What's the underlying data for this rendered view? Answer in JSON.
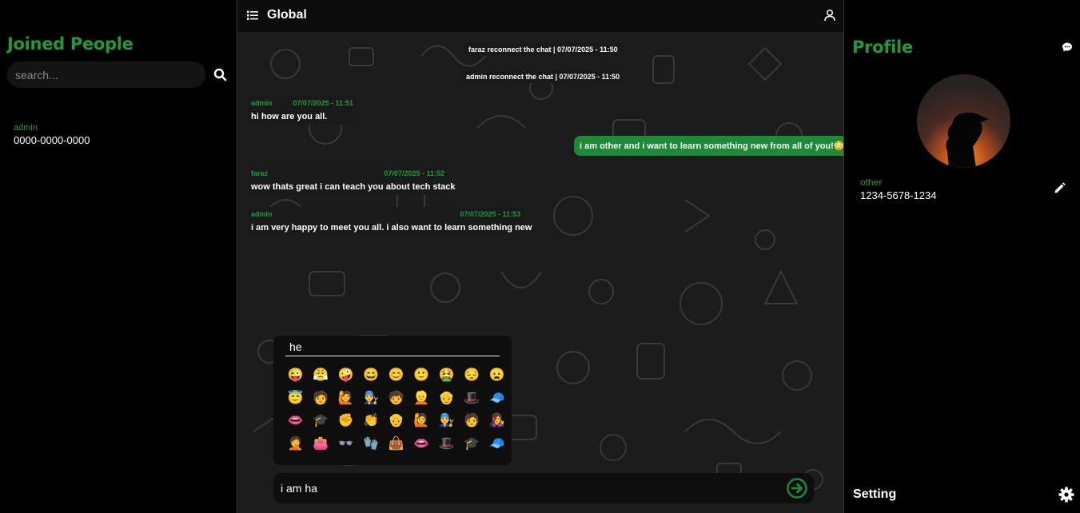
{
  "left": {
    "title": "Joined People",
    "search_placeholder": "search...",
    "people": [
      {
        "name": "admin",
        "phone": "0000-0000-0000"
      }
    ]
  },
  "chat": {
    "title": "Global",
    "system_messages": [
      "faraz reconnect the chat | 07/07/2025 - 11:50",
      "admin reconnect the chat | 07/07/2025 - 11:50"
    ],
    "messages": [
      {
        "sender": "admin",
        "time": "07/07/2025 - 11:51",
        "text": "hi how are you all."
      },
      {
        "mine": true,
        "text": "i am other and i want to learn something new from all of you!😳"
      },
      {
        "sender": "faraz",
        "time": "07/07/2025 - 11:52",
        "text": "wow thats great i can teach you about tech stack"
      },
      {
        "sender": "admin",
        "time": "07/07/2025 - 11:53",
        "text": "i am very happy to meet you all. i also want to learn something new"
      }
    ],
    "emoji_search_value": "he",
    "emojis": [
      "😜",
      "😤",
      "🤪",
      "😄",
      "😊",
      "🙂",
      "🤮",
      "😔",
      "😦",
      "😇",
      "🧑",
      "🙋",
      "👨‍🔧",
      "🧒",
      "👱",
      "👴",
      "🎩",
      "🧢",
      "👄",
      "🎓",
      "✊",
      "👏",
      "👴",
      "🙋",
      "👨‍🔧",
      "🧑",
      "👩‍🎤",
      "🤦",
      "👛",
      "👓",
      "🧤",
      "👜",
      "👄",
      "🎩",
      "🎓",
      "🧢"
    ],
    "composer_value": "i am ha"
  },
  "right": {
    "title": "Profile",
    "name": "other",
    "phone": "1234-5678-1234",
    "setting_label": "Setting"
  },
  "colors": {
    "accent": "#1f9b3a",
    "own_bubble": "#1d8a36",
    "background": "#000000"
  }
}
